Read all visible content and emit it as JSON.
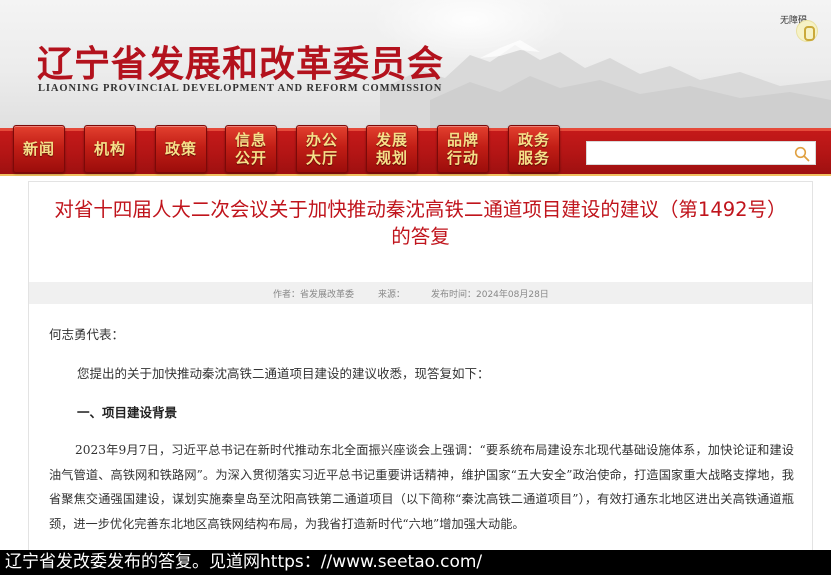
{
  "header": {
    "logo_cn": "辽宁省发展和改革委员会",
    "logo_en": "LIAONING PROVINCIAL DEVELOPMENT AND REFORM COMMISSION",
    "accessible_label": "无障碍"
  },
  "nav": [
    {
      "line1": "新闻",
      "line2": ""
    },
    {
      "line1": "机构",
      "line2": ""
    },
    {
      "line1": "政策",
      "line2": ""
    },
    {
      "line1": "信息",
      "line2": "公开"
    },
    {
      "line1": "办公",
      "line2": "大厅"
    },
    {
      "line1": "发展",
      "line2": "规划"
    },
    {
      "line1": "品牌",
      "line2": "行动"
    },
    {
      "line1": "政务",
      "line2": "服务"
    }
  ],
  "search": {
    "placeholder": "",
    "value": ""
  },
  "article": {
    "title": "对省十四届人大二次会议关于加快推动秦沈高铁二通道项目建设的建议（第1492号）的答复",
    "author": "作者：省发展改革委",
    "source": "来源：",
    "publish_time": "发布时间：2024年08月28日",
    "salutation": "何志勇代表：",
    "intro": "您提出的关于加快推动秦沈高铁二通道项目建设的建议收悉，现答复如下：",
    "section_1_heading": "一、项目建设背景",
    "paragraph_1": "2023年9月7日，习近平总书记在新时代推动东北全面振兴座谈会上强调：“要系统布局建设东北现代基础设施体系，加快论证和建设油气管道、高铁网和铁路网”。为深入贯彻落实习近平总书记重要讲话精神，维护国家“五大安全”政治使命，打造国家重大战略支撑地，我省聚焦交通强国建设，谋划实施秦皇岛至沈阳高铁第二通道项目（以下简称“秦沈高铁二通道项目”），有效打通东北地区进出关高铁通道瓶颈，进一步优化完善东北地区高铁网结构布局，为我省打造新时代“六地”增加强大动能。"
  },
  "caption": "辽宁省发改委发布的答复。见道网https：//www.seetao.com/",
  "colors": {
    "brand_red": "#b3121d",
    "title_red": "#c0141c",
    "nav_text_gold": "#f6e089",
    "search_icon": "#e0a040"
  },
  "icons": [
    "search-icon",
    "accessibility-icon"
  ]
}
